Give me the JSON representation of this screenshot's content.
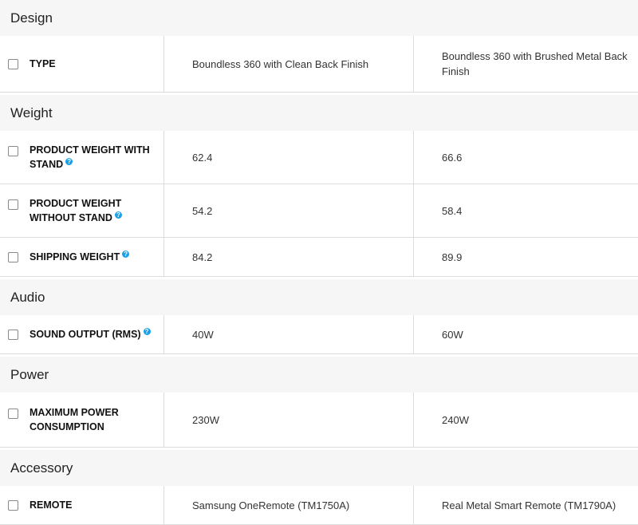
{
  "sections": [
    {
      "title": "Design",
      "rows": [
        {
          "label": "TYPE",
          "value1": "Boundless 360 with Clean Back Finish",
          "value2": "Boundless 360 with Brushed Metal Back Finish"
        }
      ]
    },
    {
      "title": "Weight",
      "rows": [
        {
          "label_line1": "PRODUCT WEIGHT WITH",
          "label_line2": "STAND",
          "value1": "62.4",
          "value2": "66.6",
          "help_icon": "question-icon"
        },
        {
          "label_line1": "PRODUCT WEIGHT",
          "label_line2": "WITHOUT STAND",
          "value1": "54.2",
          "value2": "58.4",
          "help_icon": "question-icon"
        },
        {
          "label": "SHIPPING WEIGHT",
          "value1": "84.2",
          "value2": "89.9",
          "help_icon": "question-icon"
        }
      ]
    },
    {
      "title": "Audio",
      "rows": [
        {
          "label": "SOUND OUTPUT (RMS)",
          "value1": "40W",
          "value2": "60W",
          "help_icon": "question-icon"
        }
      ]
    },
    {
      "title": "Power",
      "rows": [
        {
          "label_line1": "MAXIMUM POWER",
          "label_line2": "CONSUMPTION",
          "value1": "230W",
          "value2": "240W"
        }
      ]
    },
    {
      "title": "Accessory",
      "rows": [
        {
          "label": "REMOTE",
          "value1": "Samsung OneRemote (TM1750A)",
          "value2": "Real Metal Smart Remote (TM1790A)"
        }
      ]
    }
  ],
  "colors": {
    "help_icon": "#1aa0e6",
    "section_bg": "#f6f6f6",
    "divider": "#dcdcdc"
  }
}
